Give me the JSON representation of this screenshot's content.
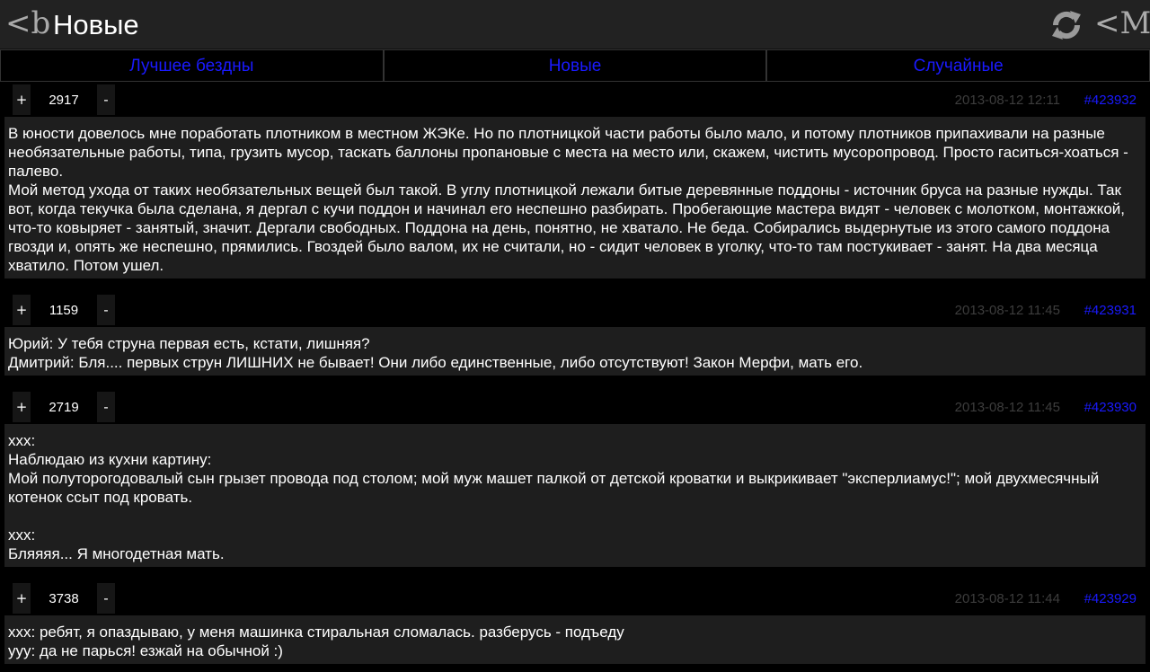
{
  "header": {
    "logo": "<b",
    "title": "Новые",
    "menu_logo": "<M"
  },
  "tabs": [
    {
      "label": "Лучшее бездны"
    },
    {
      "label": "Новые"
    },
    {
      "label": "Случайные"
    }
  ],
  "vote": {
    "plus": "+",
    "minus": "-"
  },
  "quotes": [
    {
      "rating": "2917",
      "date": "2013-08-12 12:11",
      "id": "#423932",
      "text": "В юности довелось мне поработать плотником в местном ЖЭКе. Но по плотницкой части работы было мало, и потому плотников припахивали на разные необязательные работы, типа, грузить мусор, таскать баллоны пропановые с места на место или, скажем, чистить мусоропровод. Просто гаситься-хоаться - палево.\nМой метод ухода от таких необязательных вещей был такой. В углу плотницкой лежали битые деревянные поддоны - источник бруса на разные нужды. Так вот, когда текучка была сделана, я дергал с кучи поддон и начинал его неспешно разбирать. Пробегающие мастера видят - человек с молотком, монтажкой, что-то ковыряет - занятый, значит. Дергали свободных. Поддона на день, понятно, не хватало. Не беда. Собирались выдернутые из этого самого поддона гвозди и, опять же неспешно, прямились. Гвоздей было валом, их не считали, но - сидит человек в уголку, что-то там постукивает - занят. На два месяца хватило. Потом ушел."
    },
    {
      "rating": "1159",
      "date": "2013-08-12 11:45",
      "id": "#423931",
      "text": "Юрий: У тебя струна первая есть, кстати, лишняя?\nДмитрий: Бля.... первых струн ЛИШНИХ не бывает! Они либо единственные, либо отсутствуют! Закон Мерфи, мать его."
    },
    {
      "rating": "2719",
      "date": "2013-08-12 11:45",
      "id": "#423930",
      "text": "xxx:\nНаблюдаю из кухни картину:\nМой полуторогодовалый сын грызет провода под столом; мой муж машет палкой от детской кроватки и выкрикивает \"эксперлиамус!\"; мой двухмесячный котенок ссыт под кровать.\n\nxxx:\nБляяяя... Я многодетная мать."
    },
    {
      "rating": "3738",
      "date": "2013-08-12 11:44",
      "id": "#423929",
      "text": "xxx: ребят, я опаздываю, у меня машинка стиральная сломалась. разберусь - подъеду\nyyy: да не парься! езжай на обычной :)"
    }
  ]
}
